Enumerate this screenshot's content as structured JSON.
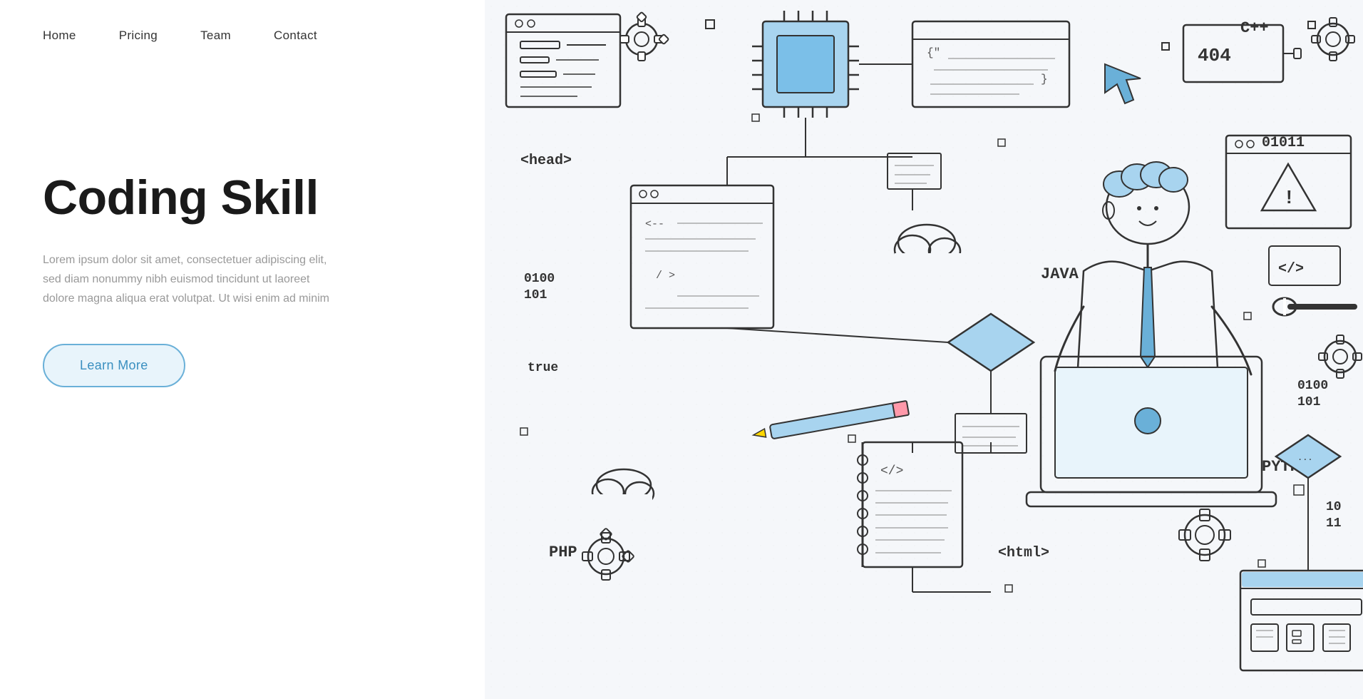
{
  "nav": {
    "items": [
      {
        "label": "Home",
        "id": "home"
      },
      {
        "label": "Pricing",
        "id": "pricing"
      },
      {
        "label": "Team",
        "id": "team"
      },
      {
        "label": "Contact",
        "id": "contact"
      }
    ]
  },
  "hero": {
    "title": "Coding Skill",
    "description": "Lorem ipsum dolor sit amet, consectetuer adipiscing elit,\nsed diam nonummy nibh euismod tincidunt ut laoreet\ndolore magna aliqua erat volutpat. Ut wisi enim ad minim",
    "cta_label": "Learn More"
  },
  "illustration": {
    "labels": {
      "cpp": "C++",
      "head": "<head>",
      "binary1": "01011",
      "java": "JAVA",
      "binary2": "0100\n101",
      "true_label": "true",
      "php": "PHP",
      "html_tag": "<html>",
      "python": "PYTHON",
      "binary3": "10\n11",
      "code_tag": "</>"
    }
  },
  "colors": {
    "blue_accent": "#6ab0d8",
    "blue_fill": "#a8d4ef",
    "text_dark": "#1a1a1a",
    "text_light": "#999",
    "nav_text": "#333",
    "border": "#333"
  }
}
